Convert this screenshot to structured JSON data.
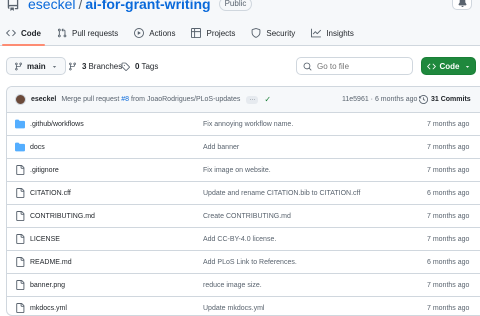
{
  "repo": {
    "owner": "eseckel",
    "separator": "/",
    "name": "ai-for-grant-writing",
    "visibility": "Public"
  },
  "tabs": [
    {
      "label": "Code",
      "icon": "code-icon",
      "selected": true
    },
    {
      "label": "Pull requests",
      "icon": "pull-request-icon"
    },
    {
      "label": "Actions",
      "icon": "play-icon"
    },
    {
      "label": "Projects",
      "icon": "table-icon"
    },
    {
      "label": "Security",
      "icon": "shield-icon"
    },
    {
      "label": "Insights",
      "icon": "graph-icon"
    }
  ],
  "toolbar": {
    "branch": "main",
    "branches_count": "3",
    "branches_label": "Branches",
    "tags_count": "0",
    "tags_label": "Tags",
    "search_placeholder": "Go to file",
    "code_button": "Code"
  },
  "commit": {
    "author": "eseckel",
    "message_prefix": "Merge pull request",
    "pr_link": "#8",
    "message_suffix": "from JoaoRodrigues/PLoS-updates",
    "ellipsis": "···",
    "check": "✓",
    "hash_time": "11e5961 · 6 months ago",
    "count": "31 Commits"
  },
  "files": [
    {
      "type": "dir",
      "name": ".github/workflows",
      "message": "Fix annoying workflow name.",
      "date": "7 months ago"
    },
    {
      "type": "dir",
      "name": "docs",
      "message": "Add banner",
      "date": "7 months ago"
    },
    {
      "type": "file",
      "name": ".gitignore",
      "message": "Fix image on website.",
      "date": "7 months ago"
    },
    {
      "type": "file",
      "name": "CITATION.cff",
      "message": "Update and rename CITATION.bib to CITATION.cff",
      "date": "6 months ago"
    },
    {
      "type": "file",
      "name": "CONTRIBUTING.md",
      "message": "Create CONTRIBUTING.md",
      "date": "7 months ago"
    },
    {
      "type": "file",
      "name": "LICENSE",
      "message": "Add CC-BY-4.0 license.",
      "date": "7 months ago"
    },
    {
      "type": "file",
      "name": "README.md",
      "message": "Add PLoS Link to References.",
      "date": "6 months ago"
    },
    {
      "type": "file",
      "name": "banner.png",
      "message": "reduce image size.",
      "date": "7 months ago"
    },
    {
      "type": "file",
      "name": "mkdocs.yml",
      "message": "Update mkdocs.yml",
      "date": "7 months ago"
    }
  ],
  "colors": {
    "accent": "#0969da",
    "folder": "#54aeff",
    "primary_button": "#1f883d",
    "tab_underline": "#fd8c73"
  }
}
